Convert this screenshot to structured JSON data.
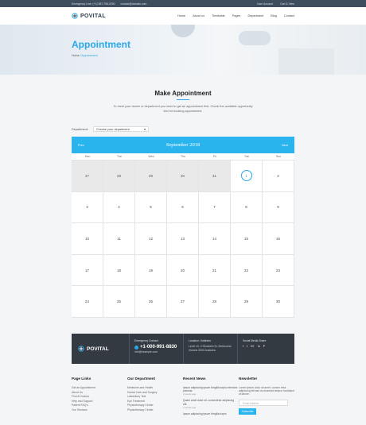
{
  "topbar": {
    "phone": "Emergency Line: (+1) 987-796-0290",
    "email": "contact@domain.com",
    "account": "User Account",
    "cart": "Cart & View"
  },
  "nav": {
    "brand": "POVITAL",
    "items": [
      "Home",
      "About us",
      "Timetable",
      "Pages",
      "Department",
      "Blog",
      "Contact"
    ]
  },
  "hero": {
    "title": "Appointment",
    "crumb_home": "Home",
    "crumb_current": "Appointment"
  },
  "section": {
    "title": "Make Appointment",
    "intro": "To meet your doctor or department you need to get an appointment first. Check the available opportunity first for booking appointment."
  },
  "department": {
    "label": "Department:",
    "value": "Choose your department"
  },
  "calendar": {
    "prev": "Prev",
    "next": "Next",
    "month": "September 2018",
    "weekdays": [
      "Mon",
      "Tue",
      "Wed",
      "Thu",
      "Fri",
      "Sat",
      "Sun"
    ],
    "cells": [
      "27",
      "28",
      "29",
      "30",
      "31",
      "1",
      "2",
      "3",
      "4",
      "5",
      "6",
      "7",
      "8",
      "9",
      "10",
      "11",
      "12",
      "13",
      "14",
      "15",
      "16",
      "17",
      "18",
      "19",
      "20",
      "21",
      "22",
      "23",
      "24",
      "25",
      "26",
      "27",
      "28",
      "29",
      "30"
    ],
    "previous_month_count": 5,
    "today": "1",
    "colors": {
      "accent": "#2ab4ee"
    }
  },
  "contact": {
    "brand": "POVITAL",
    "emergency_label": "Emergency Contact",
    "phone": "+1-000-991-8830",
    "email": "info@example.com",
    "location_label": "Location / Address",
    "address": "Level 13, 2 Elizabeth St, Melbourne, Victoria 3000 Australia",
    "social_label": "Social Media Share",
    "social": [
      "f",
      "t",
      "G+",
      "in",
      "P"
    ]
  },
  "footer": {
    "col1": {
      "title": "Page Links",
      "items": [
        "Get an Appointment",
        "About Us",
        "Find A Doctors",
        "Help and Support",
        "Patient FAQ's",
        "Our Services"
      ]
    },
    "col2": {
      "title": "Our Department",
      "items": [
        "Medecine and Health",
        "Dental Care and Surgery",
        "Laboratory Test",
        "Eye Treatment",
        "Physiotherapy Center",
        "Physiotherapy Center"
      ]
    },
    "col3": {
      "title": "Recent News",
      "items": [
        {
          "text": "Ipsum adipiscing ipsum fringilla turpis interdum pulvinar.",
          "date": "2 weeks ago"
        },
        {
          "text": "Quam amet dolor sit, consectetur adipiscing elit.",
          "date": "2 weeks ago"
        },
        {
          "text": "Ipsum adipiscing ipsum fringilla turpis",
          "date": ""
        }
      ]
    },
    "col4": {
      "title": "Newsletter",
      "text": "Lorem ipsum dolor sit amet, consec tetur adipiscing elit sed do eiusmod tempor incididunt ut labore.",
      "placeholder": "Email Address",
      "button": "Subscribe"
    }
  }
}
